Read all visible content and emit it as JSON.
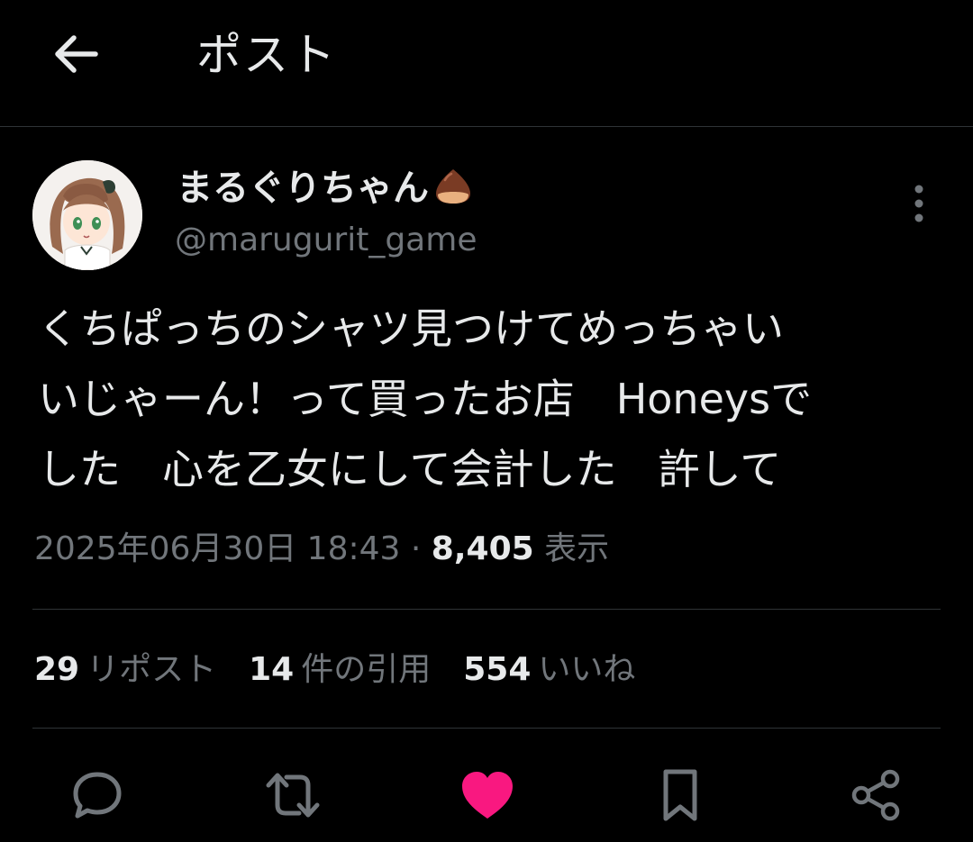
{
  "header": {
    "title": "ポスト"
  },
  "author": {
    "display_name": "まるぐりちゃん",
    "handle": "@marugurit_game"
  },
  "post": {
    "text": "くちぱっちのシャツ見つけてめっちゃい\nいじゃーん！って買ったお店　Honeysで\nした　心を乙女にして会計した　許して"
  },
  "meta": {
    "timestamp": "2025年06月30日 18:43",
    "separator": "·",
    "views_count": "8,405",
    "views_label": "表示"
  },
  "stats": {
    "reposts_count": "29",
    "reposts_label": "リポスト",
    "quotes_count": "14",
    "quotes_label": "件の引用",
    "likes_count": "554",
    "likes_label": "いいね"
  },
  "icons": {
    "back": "arrow-left-icon",
    "more": "more-vertical-icon",
    "reply": "reply-icon",
    "repost": "repost-icon",
    "like": "heart-icon",
    "bookmark": "bookmark-icon",
    "share": "share-icon",
    "chestnut": "chestnut-emoji"
  },
  "colors": {
    "background": "#000000",
    "text": "#e7e9ea",
    "secondary": "#71767b",
    "divider": "#2f3336",
    "liked": "#f91880"
  }
}
